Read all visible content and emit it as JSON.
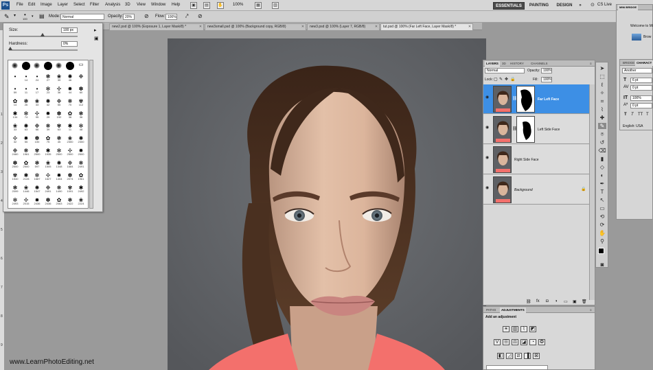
{
  "menubar": {
    "logo": "Ps",
    "items": [
      "File",
      "Edit",
      "Image",
      "Layer",
      "Select",
      "Filter",
      "Analysis",
      "3D",
      "View",
      "Window",
      "Help"
    ],
    "zoom": "100%",
    "workspaces": [
      "ESSENTIALS",
      "PAINTING",
      "DESIGN",
      "»"
    ],
    "cs_live": "CS Live"
  },
  "options": {
    "brush_size": "100",
    "mode_label": "Mode:",
    "mode_value": "Normal",
    "opacity_label": "Opacity:",
    "opacity_value": "20%",
    "flow_label": "Flow:",
    "flow_value": "100%"
  },
  "document_tabs": [
    "new2.psd @ 100% (Exposure 1, Layer Mask/8) *",
    "new3small.psd @ 100% (Background copy, RGB/8)",
    "new3.psd @ 100% (Layer 7, RGB/8)",
    "tut.psd @ 100% (Far Left Face, Layer Mask/8) *"
  ],
  "brush_panel": {
    "size_label": "Size:",
    "size_value": "100 px",
    "hardness_label": "Hardness:",
    "hardness_value": "0%",
    "brush_numbers": [
      "",
      "",
      "",
      "",
      "",
      "",
      "",
      "",
      "14",
      "24",
      "27",
      "39",
      "46",
      "",
      "59",
      "11",
      "17",
      "23",
      "36",
      "44",
      "60",
      "14",
      "26",
      "33",
      "42",
      "55",
      "70",
      "112",
      "134",
      "74",
      "95",
      "29",
      "192",
      "36",
      "36",
      "33",
      "63",
      "66",
      "39",
      "63",
      "11",
      "48",
      "32",
      "55",
      "100",
      "75",
      "45",
      "2300",
      "2300",
      "2460",
      "1961",
      "2500",
      "1935",
      "2500",
      "2500",
      "2500",
      "2500",
      "2500",
      "597",
      "1505",
      "1348",
      "1684",
      "2491",
      "1540",
      "2128",
      "1687",
      "1627",
      "1404",
      "2074",
      "1961",
      "2099",
      "1446",
      "1547",
      "2491",
      "1490",
      "1091",
      "2492",
      "2493",
      "2015",
      "2436",
      "2436",
      "2063",
      "2422",
      "2224"
    ]
  },
  "ruler": [
    "1",
    "2",
    "3",
    "4",
    "5",
    "6",
    "7",
    "8",
    "9"
  ],
  "watermark": "www.LearnPhotoEditing.net",
  "layers_panel": {
    "tabs": [
      "LAYERS",
      "3D",
      "HISTORY",
      "CHANNELS"
    ],
    "blend_mode": "Normal",
    "opacity_label": "Opacity:",
    "opacity_value": "100%",
    "lock_label": "Lock:",
    "fill_label": "Fill:",
    "fill_value": "100%",
    "layers": [
      {
        "name": "Far Left Face",
        "selected": true,
        "has_mask": true
      },
      {
        "name": "Left Side Face",
        "selected": false,
        "has_mask": true
      },
      {
        "name": "Right Side Face",
        "selected": false,
        "has_mask": false
      },
      {
        "name": "Background",
        "selected": false,
        "has_mask": false,
        "italic": true
      }
    ]
  },
  "adjustments_panel": {
    "tabs": [
      "PATHS",
      "ADJUSTMENTS"
    ],
    "title": "Add an adjustment"
  },
  "mini_bridge": {
    "title": "MINI BRIDGE",
    "welcome": "Welcome to Mi",
    "browse": "Brow"
  },
  "character_panel": {
    "tabs": [
      "BRIDGE",
      "CHARACT"
    ],
    "font": "Another",
    "size": "6 pt",
    "leading": "0 pt",
    "scale": "100%",
    "tracking": "0 pt",
    "styles": [
      "T",
      "T",
      "TT",
      "T"
    ],
    "language": "English: USA"
  },
  "colors": {
    "selection": "#3d8fe5",
    "workspace_active": "#4a4a4a",
    "backdrop": "#616368",
    "shirt": "#f3706c"
  }
}
